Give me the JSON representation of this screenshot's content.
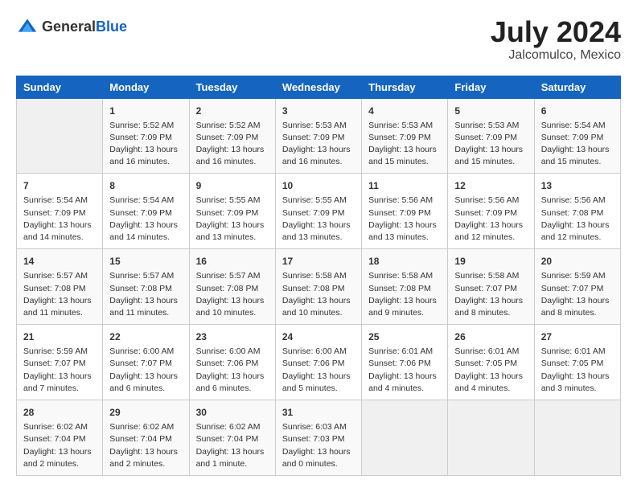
{
  "header": {
    "logo": {
      "general": "General",
      "blue": "Blue"
    },
    "title": "July 2024",
    "location": "Jalcomulco, Mexico"
  },
  "calendar": {
    "days_of_week": [
      "Sunday",
      "Monday",
      "Tuesday",
      "Wednesday",
      "Thursday",
      "Friday",
      "Saturday"
    ],
    "weeks": [
      [
        {
          "day": "",
          "empty": true
        },
        {
          "day": "1",
          "sunrise": "Sunrise: 5:52 AM",
          "sunset": "Sunset: 7:09 PM",
          "daylight": "Daylight: 13 hours and 16 minutes."
        },
        {
          "day": "2",
          "sunrise": "Sunrise: 5:52 AM",
          "sunset": "Sunset: 7:09 PM",
          "daylight": "Daylight: 13 hours and 16 minutes."
        },
        {
          "day": "3",
          "sunrise": "Sunrise: 5:53 AM",
          "sunset": "Sunset: 7:09 PM",
          "daylight": "Daylight: 13 hours and 16 minutes."
        },
        {
          "day": "4",
          "sunrise": "Sunrise: 5:53 AM",
          "sunset": "Sunset: 7:09 PM",
          "daylight": "Daylight: 13 hours and 15 minutes."
        },
        {
          "day": "5",
          "sunrise": "Sunrise: 5:53 AM",
          "sunset": "Sunset: 7:09 PM",
          "daylight": "Daylight: 13 hours and 15 minutes."
        },
        {
          "day": "6",
          "sunrise": "Sunrise: 5:54 AM",
          "sunset": "Sunset: 7:09 PM",
          "daylight": "Daylight: 13 hours and 15 minutes."
        }
      ],
      [
        {
          "day": "7",
          "sunrise": "Sunrise: 5:54 AM",
          "sunset": "Sunset: 7:09 PM",
          "daylight": "Daylight: 13 hours and 14 minutes."
        },
        {
          "day": "8",
          "sunrise": "Sunrise: 5:54 AM",
          "sunset": "Sunset: 7:09 PM",
          "daylight": "Daylight: 13 hours and 14 minutes."
        },
        {
          "day": "9",
          "sunrise": "Sunrise: 5:55 AM",
          "sunset": "Sunset: 7:09 PM",
          "daylight": "Daylight: 13 hours and 13 minutes."
        },
        {
          "day": "10",
          "sunrise": "Sunrise: 5:55 AM",
          "sunset": "Sunset: 7:09 PM",
          "daylight": "Daylight: 13 hours and 13 minutes."
        },
        {
          "day": "11",
          "sunrise": "Sunrise: 5:56 AM",
          "sunset": "Sunset: 7:09 PM",
          "daylight": "Daylight: 13 hours and 13 minutes."
        },
        {
          "day": "12",
          "sunrise": "Sunrise: 5:56 AM",
          "sunset": "Sunset: 7:09 PM",
          "daylight": "Daylight: 13 hours and 12 minutes."
        },
        {
          "day": "13",
          "sunrise": "Sunrise: 5:56 AM",
          "sunset": "Sunset: 7:08 PM",
          "daylight": "Daylight: 13 hours and 12 minutes."
        }
      ],
      [
        {
          "day": "14",
          "sunrise": "Sunrise: 5:57 AM",
          "sunset": "Sunset: 7:08 PM",
          "daylight": "Daylight: 13 hours and 11 minutes."
        },
        {
          "day": "15",
          "sunrise": "Sunrise: 5:57 AM",
          "sunset": "Sunset: 7:08 PM",
          "daylight": "Daylight: 13 hours and 11 minutes."
        },
        {
          "day": "16",
          "sunrise": "Sunrise: 5:57 AM",
          "sunset": "Sunset: 7:08 PM",
          "daylight": "Daylight: 13 hours and 10 minutes."
        },
        {
          "day": "17",
          "sunrise": "Sunrise: 5:58 AM",
          "sunset": "Sunset: 7:08 PM",
          "daylight": "Daylight: 13 hours and 10 minutes."
        },
        {
          "day": "18",
          "sunrise": "Sunrise: 5:58 AM",
          "sunset": "Sunset: 7:08 PM",
          "daylight": "Daylight: 13 hours and 9 minutes."
        },
        {
          "day": "19",
          "sunrise": "Sunrise: 5:58 AM",
          "sunset": "Sunset: 7:07 PM",
          "daylight": "Daylight: 13 hours and 8 minutes."
        },
        {
          "day": "20",
          "sunrise": "Sunrise: 5:59 AM",
          "sunset": "Sunset: 7:07 PM",
          "daylight": "Daylight: 13 hours and 8 minutes."
        }
      ],
      [
        {
          "day": "21",
          "sunrise": "Sunrise: 5:59 AM",
          "sunset": "Sunset: 7:07 PM",
          "daylight": "Daylight: 13 hours and 7 minutes."
        },
        {
          "day": "22",
          "sunrise": "Sunrise: 6:00 AM",
          "sunset": "Sunset: 7:07 PM",
          "daylight": "Daylight: 13 hours and 6 minutes."
        },
        {
          "day": "23",
          "sunrise": "Sunrise: 6:00 AM",
          "sunset": "Sunset: 7:06 PM",
          "daylight": "Daylight: 13 hours and 6 minutes."
        },
        {
          "day": "24",
          "sunrise": "Sunrise: 6:00 AM",
          "sunset": "Sunset: 7:06 PM",
          "daylight": "Daylight: 13 hours and 5 minutes."
        },
        {
          "day": "25",
          "sunrise": "Sunrise: 6:01 AM",
          "sunset": "Sunset: 7:06 PM",
          "daylight": "Daylight: 13 hours and 4 minutes."
        },
        {
          "day": "26",
          "sunrise": "Sunrise: 6:01 AM",
          "sunset": "Sunset: 7:05 PM",
          "daylight": "Daylight: 13 hours and 4 minutes."
        },
        {
          "day": "27",
          "sunrise": "Sunrise: 6:01 AM",
          "sunset": "Sunset: 7:05 PM",
          "daylight": "Daylight: 13 hours and 3 minutes."
        }
      ],
      [
        {
          "day": "28",
          "sunrise": "Sunrise: 6:02 AM",
          "sunset": "Sunset: 7:04 PM",
          "daylight": "Daylight: 13 hours and 2 minutes."
        },
        {
          "day": "29",
          "sunrise": "Sunrise: 6:02 AM",
          "sunset": "Sunset: 7:04 PM",
          "daylight": "Daylight: 13 hours and 2 minutes."
        },
        {
          "day": "30",
          "sunrise": "Sunrise: 6:02 AM",
          "sunset": "Sunset: 7:04 PM",
          "daylight": "Daylight: 13 hours and 1 minute."
        },
        {
          "day": "31",
          "sunrise": "Sunrise: 6:03 AM",
          "sunset": "Sunset: 7:03 PM",
          "daylight": "Daylight: 13 hours and 0 minutes."
        },
        {
          "day": "",
          "empty": true
        },
        {
          "day": "",
          "empty": true
        },
        {
          "day": "",
          "empty": true
        }
      ]
    ]
  }
}
